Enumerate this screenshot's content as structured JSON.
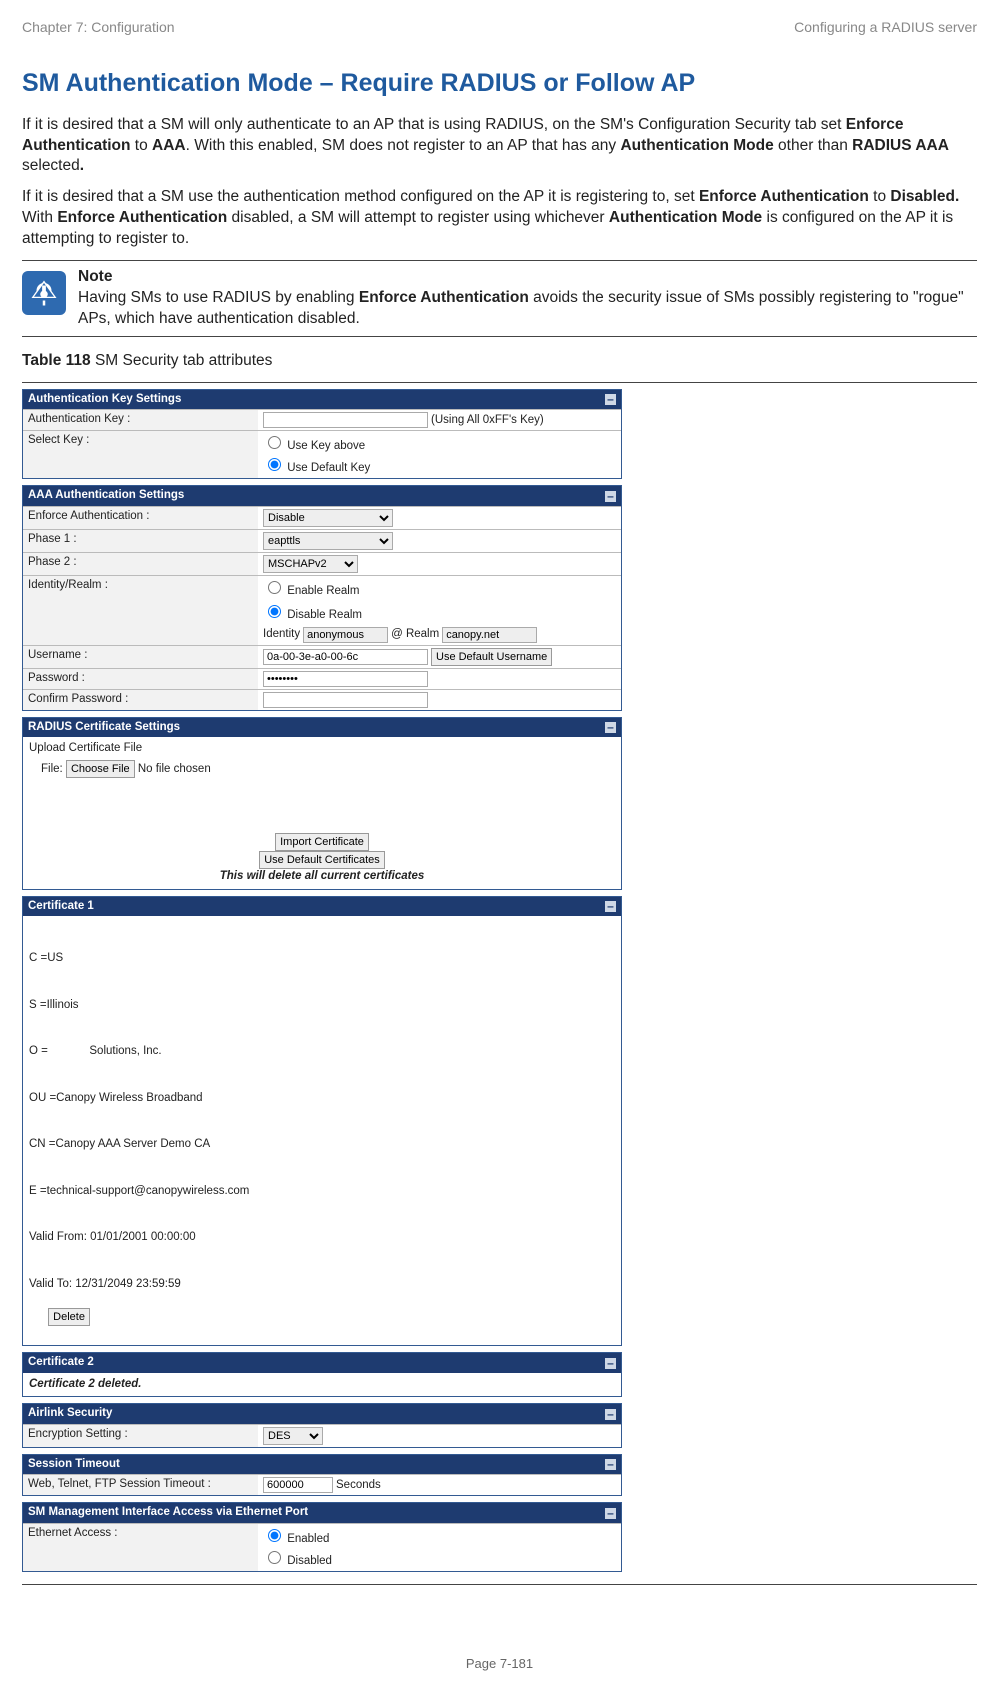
{
  "header": {
    "left": "Chapter 7:  Configuration",
    "right": "Configuring a RADIUS server"
  },
  "title": "SM Authentication Mode – Require RADIUS or Follow AP",
  "paragraphs": {
    "p1_a": "If it is desired that a SM will only authenticate to an AP that is using RADIUS, on the SM's Configuration Security tab set ",
    "p1_b1": "Enforce Authentication",
    "p1_c": " to ",
    "p1_b2": "AAA",
    "p1_d": ". With this enabled, SM does not register to an AP that has any ",
    "p1_b3": "Authentication Mode",
    "p1_e": " other than ",
    "p1_b4": "RADIUS AAA",
    "p1_f": " selected",
    "p1_dot": ".",
    "p2_a": "If it is desired that a SM use the authentication method configured on the AP it is registering to, set ",
    "p2_b1": "Enforce Authentication",
    "p2_c": " to ",
    "p2_b2": "Disabled.",
    "p2_d": " With ",
    "p2_b3": "Enforce Authentication",
    "p2_e": " disabled, a SM will attempt to register using whichever ",
    "p2_b4": "Authentication Mode",
    "p2_f": " is configured on the AP it is attempting to register to."
  },
  "note": {
    "heading": "Note",
    "body_a": "Having SMs to use RADIUS by enabling ",
    "body_b": "Enforce Authentication",
    "body_c": " avoids the security issue of SMs possibly registering to \"rogue\" APs, which have authentication disabled."
  },
  "table_caption_bold": "Table 118",
  "table_caption_rest": " SM Security tab attributes",
  "form": {
    "auth_key": {
      "title": "Authentication Key Settings",
      "row1_label": "Authentication Key :",
      "row1_hint": "(Using All 0xFF's Key)",
      "row2_label": "Select Key :",
      "row2_opt1": "Use Key above",
      "row2_opt2": "Use Default Key"
    },
    "aaa": {
      "title": "AAA Authentication Settings",
      "enforce_label": "Enforce Authentication :",
      "enforce_value": "Disable",
      "phase1_label": "Phase 1 :",
      "phase1_value": "eapttls",
      "phase2_label": "Phase 2 :",
      "phase2_value": "MSCHAPv2",
      "idrealm_label": "Identity/Realm :",
      "idrealm_opt1": "Enable Realm",
      "idrealm_opt2": "Disable Realm",
      "identity_word": "Identity",
      "identity_val": "anonymous",
      "at_realm": "@ Realm",
      "realm_val": "canopy.net",
      "user_label": "Username :",
      "user_val": "0a-00-3e-a0-00-6c",
      "user_btn": "Use Default Username",
      "pass_label": "Password :",
      "pass_val": "••••••••",
      "confirm_label": "Confirm Password :"
    },
    "radius_cert": {
      "title": "RADIUS Certificate Settings",
      "upload_label": "Upload Certificate File",
      "file_word": "File:",
      "choose": "Choose File",
      "nofile": "No file chosen",
      "import_btn": "Import Certificate",
      "default_btn": "Use Default Certificates",
      "warn": "This will delete all current certificates"
    },
    "cert1": {
      "title": "Certificate 1",
      "lines": [
        "C =US",
        "S =Illinois",
        "O =             Solutions, Inc.",
        "OU =Canopy Wireless Broadband",
        "CN =Canopy AAA Server Demo CA",
        "E =technical-support@canopywireless.com",
        "Valid From: 01/01/2001 00:00:00",
        "Valid To: 12/31/2049 23:59:59"
      ],
      "delete": "Delete"
    },
    "cert2": {
      "title": "Certificate 2",
      "text": "Certificate 2 deleted."
    },
    "airlink": {
      "title": "Airlink Security",
      "enc_label": "Encryption Setting :",
      "enc_val": "DES"
    },
    "session": {
      "title": "Session Timeout",
      "label": "Web, Telnet, FTP Session Timeout :",
      "val": "600000",
      "unit": "Seconds"
    },
    "mgmt": {
      "title": "SM Management Interface Access via Ethernet Port",
      "label": "Ethernet Access :",
      "opt1": "Enabled",
      "opt2": "Disabled"
    }
  },
  "footer": "Page 7-181"
}
